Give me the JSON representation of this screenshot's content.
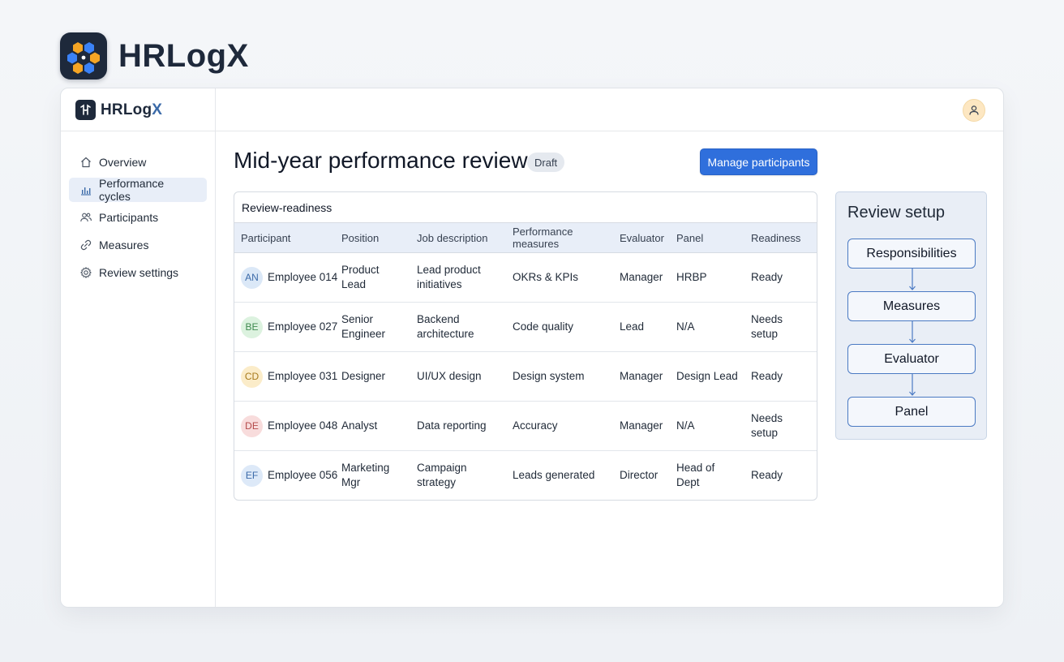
{
  "brand": {
    "name": "HRLogX"
  },
  "app": {
    "logo_text_primary": "HRLog",
    "logo_text_accent": "X"
  },
  "sidebar": {
    "items": [
      {
        "label": "Overview",
        "icon": "home-icon",
        "active": false
      },
      {
        "label": "Performance cycles",
        "icon": "bar-chart-icon",
        "active": true
      },
      {
        "label": "Participants",
        "icon": "users-icon",
        "active": false
      },
      {
        "label": "Measures",
        "icon": "link-icon",
        "active": false
      },
      {
        "label": "Review settings",
        "icon": "gear-icon",
        "active": false
      }
    ]
  },
  "header": {
    "title": "Mid-year performance review",
    "status": "Draft",
    "action_label": "Manage participants"
  },
  "table": {
    "caption": "Review-readiness",
    "columns": [
      "Participant",
      "Position",
      "Job description",
      "Performance measures",
      "Evaluator",
      "Panel",
      "Readiness"
    ],
    "rows": [
      {
        "initials": "AN",
        "participant": "Employee 014",
        "position": "Product Lead",
        "job": "Lead product initiatives",
        "measures": "OKRs & KPIs",
        "evaluator": "Manager",
        "panel": "HRBP",
        "readiness": "Ready"
      },
      {
        "initials": "BE",
        "participant": "Employee 027",
        "position": "Senior Engineer",
        "job": "Backend architecture",
        "measures": "Code quality",
        "evaluator": "Lead",
        "panel": "N/A",
        "readiness": "Needs setup"
      },
      {
        "initials": "CD",
        "participant": "Employee 031",
        "position": "Designer",
        "job": "UI/UX design",
        "measures": "Design system",
        "evaluator": "Manager",
        "panel": "Design Lead",
        "readiness": "Ready"
      },
      {
        "initials": "DE",
        "participant": "Employee 048",
        "position": "Analyst",
        "job": "Data reporting",
        "measures": "Accuracy",
        "evaluator": "Manager",
        "panel": "N/A",
        "readiness": "Needs setup"
      },
      {
        "initials": "EF",
        "participant": "Employee 056",
        "position": "Marketing Mgr",
        "job": "Campaign strategy",
        "measures": "Leads generated",
        "evaluator": "Director",
        "panel": "Head of Dept",
        "readiness": "Ready"
      }
    ]
  },
  "setup": {
    "title": "Review setup",
    "steps": [
      "Responsibilities",
      "Measures",
      "Evaluator",
      "Panel"
    ]
  },
  "colors": {
    "accent": "#2f6fdc",
    "brand_dark": "#1e293b",
    "active_nav_bg": "#e8eef8",
    "initials": [
      {
        "bg": "#dbe8f7",
        "fg": "#3b6aa8"
      },
      {
        "bg": "#dcf2df",
        "fg": "#3f8a4f"
      },
      {
        "bg": "#fbecc9",
        "fg": "#a77a1c"
      },
      {
        "bg": "#f8dcdc",
        "fg": "#b44a4a"
      },
      {
        "bg": "#dde9f8",
        "fg": "#3b6aa8"
      }
    ]
  }
}
